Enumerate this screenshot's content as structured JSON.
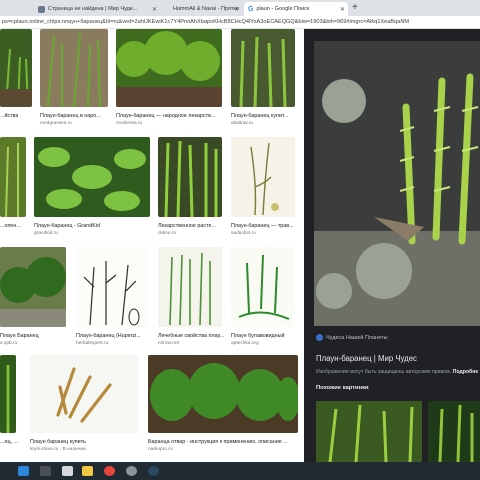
{
  "tabs": [
    {
      "title": "Страница не найдена | Мир Чуде...",
      "color": "#6b7a8a"
    },
    {
      "title": "HammAli & Navai - Прятки",
      "color": "#ff0000"
    },
    {
      "title": "plaun - Google Поиск",
      "color": "#4285f4"
    }
  ],
  "address": "ps=cplaun.online_chips:плаун+баранец&hl=ru&ved=2ahUKEwiK1c7Y4PnoAhXbapoKHcB8CHcQ4lYoA3oECAEQGQ&biw=1903&bih=969#imgrc=Alkq1XeaBqaNM",
  "results": [
    {
      "caption": "...йства",
      "source": ""
    },
    {
      "caption": "Плаун-баранец в наро...",
      "source": "medgrasses.ru"
    },
    {
      "caption": "Плаун-баранец — народное лекарств...",
      "source": "moslenka.ru"
    },
    {
      "caption": "Плаун-баранец купит...",
      "source": "altaitrav.ru"
    },
    {
      "caption": "...опен...",
      "source": ""
    },
    {
      "caption": "Плаун-баранец - GrandKid",
      "source": "grandkid.ru"
    },
    {
      "caption": "Лекарственное расте...",
      "source": "dvline.ru"
    },
    {
      "caption": "Плаун-баранец — трав...",
      "source": "sadsobin.ru"
    },
    {
      "caption": "Плаун Баранец",
      "source": "e.spb.ru"
    },
    {
      "caption": "Плаун-баранец (Huperzi...",
      "source": "herbalexpert.ru"
    },
    {
      "caption": "Лечебные свойства плау...",
      "source": "mirrav.net"
    },
    {
      "caption": "Плаун булавовидный",
      "source": "aptechka.org"
    },
    {
      "caption": "...ец, ...",
      "source": ""
    },
    {
      "caption": "Плаун баранец купить",
      "source": "krym-trava.ru · В наличии"
    },
    {
      "caption": "Баранца отвар - инструкция к применению, описание ...",
      "source": "narkopro.ru"
    }
  ],
  "panel": {
    "source": "Чудеса Нашей Планеты",
    "title": "Плаун-баранец | Мир Чудес",
    "note": "Изображения могут быть защищены авторским правом.",
    "note_link": "Подробне",
    "similar": "Похожие картинки"
  }
}
